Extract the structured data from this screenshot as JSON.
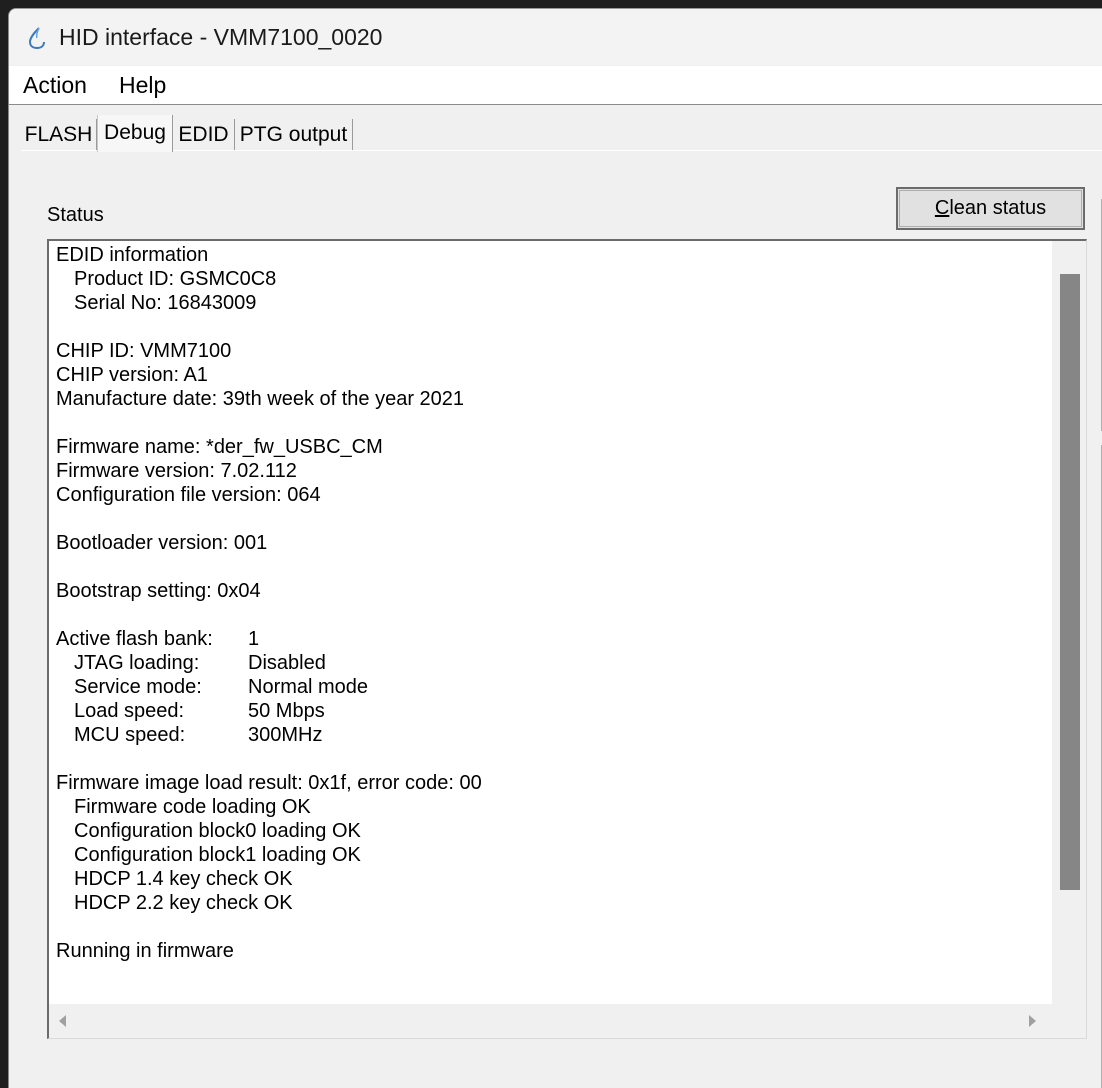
{
  "window": {
    "title": "HID interface - VMM7100_0020",
    "icon": "water-drop-icon"
  },
  "menu": [
    "Action",
    "Help"
  ],
  "tabs": [
    {
      "label": "FLASH",
      "active": false
    },
    {
      "label": "Debug",
      "active": true
    },
    {
      "label": "EDID",
      "active": false
    },
    {
      "label": "PTG output",
      "active": false
    }
  ],
  "debug": {
    "status_label": "Status",
    "clean_button": {
      "mnemonic": "C",
      "rest": "lean status"
    },
    "status_lines": [
      {
        "text": "EDID information"
      },
      {
        "text": "Product ID: GSMC0C8",
        "indent": true
      },
      {
        "text": "Serial No: 16843009",
        "indent": true
      },
      {
        "text": ""
      },
      {
        "text": "CHIP ID: VMM7100"
      },
      {
        "text": "CHIP version: A1"
      },
      {
        "text": "Manufacture date: 39th week of the year 2021"
      },
      {
        "text": ""
      },
      {
        "text": "Firmware name: *der_fw_USBC_CM"
      },
      {
        "text": "Firmware version: 7.02.112"
      },
      {
        "text": "Configuration file version: 064"
      },
      {
        "text": ""
      },
      {
        "text": "Bootloader version: 001"
      },
      {
        "text": ""
      },
      {
        "text": "Bootstrap setting: 0x04"
      },
      {
        "text": ""
      },
      {
        "key": "Active flash bank:",
        "value": "1"
      },
      {
        "key": "JTAG loading:",
        "value": "Disabled",
        "indent": true
      },
      {
        "key": "Service mode:",
        "value": "Normal mode",
        "indent": true
      },
      {
        "key": "Load speed:",
        "value": "50 Mbps",
        "indent": true
      },
      {
        "key": "MCU speed:",
        "value": "300MHz",
        "indent": true
      },
      {
        "text": ""
      },
      {
        "text": "Firmware image load result: 0x1f, error code: 00"
      },
      {
        "text": "Firmware code loading OK",
        "indent": true
      },
      {
        "text": "Configuration block0 loading OK",
        "indent": true
      },
      {
        "text": "Configuration block1 loading OK",
        "indent": true
      },
      {
        "text": "HDCP 1.4 key check OK",
        "indent": true
      },
      {
        "text": "HDCP 2.2 key check OK",
        "indent": true
      },
      {
        "text": ""
      },
      {
        "text": "Running in firmware"
      }
    ]
  }
}
